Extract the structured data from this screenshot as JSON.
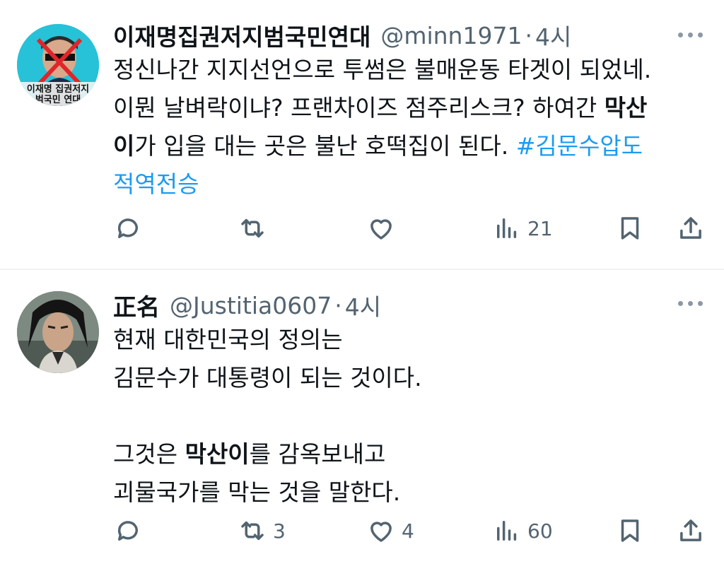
{
  "tweets": [
    {
      "name": "이재명집권저지범국민연대",
      "handle": "@minn1971",
      "dot": "·",
      "time": "4시",
      "avatar_text": "이재명 집권저지 범국민 연대",
      "body": {
        "l1": "정신나간 지지선언으로 투썸은 불매운동 타겟이 되었네.",
        "l2": "이뭔 날벼락이냐? 프랜차이즈 점주리스크? 하여간 ",
        "l2_bold": "막산",
        "l3_bold": "이",
        "l3": "가 입을 대는 곳은 불난 호떡집이 된다. ",
        "l3_hashtag": "#김문수압도",
        "l4_hashtag": "적역전승"
      },
      "counts": {
        "reply": "",
        "retweet": "",
        "like": "",
        "views": "21"
      }
    },
    {
      "name": "正名",
      "handle": "@Justitia0607",
      "dot": "·",
      "time": "4시",
      "body": {
        "l1": "현재 대한민국의 정의는",
        "l2": "김문수가 대통령이 되는 것이다.",
        "l3_pre": "그것은 ",
        "l3_bold": "막산이",
        "l3_post": "를 감옥보내고",
        "l4": "괴물국가를 막는 것을 말한다."
      },
      "counts": {
        "reply": "",
        "retweet": "3",
        "like": "4",
        "views": "60"
      }
    }
  ],
  "icons": [
    "reply-icon",
    "retweet-icon",
    "like-icon",
    "views-icon",
    "bookmark-icon",
    "share-icon",
    "more-icon"
  ],
  "colors": {
    "link": "#1d9bf0",
    "secondary": "#536471",
    "text": "#0f1419"
  }
}
